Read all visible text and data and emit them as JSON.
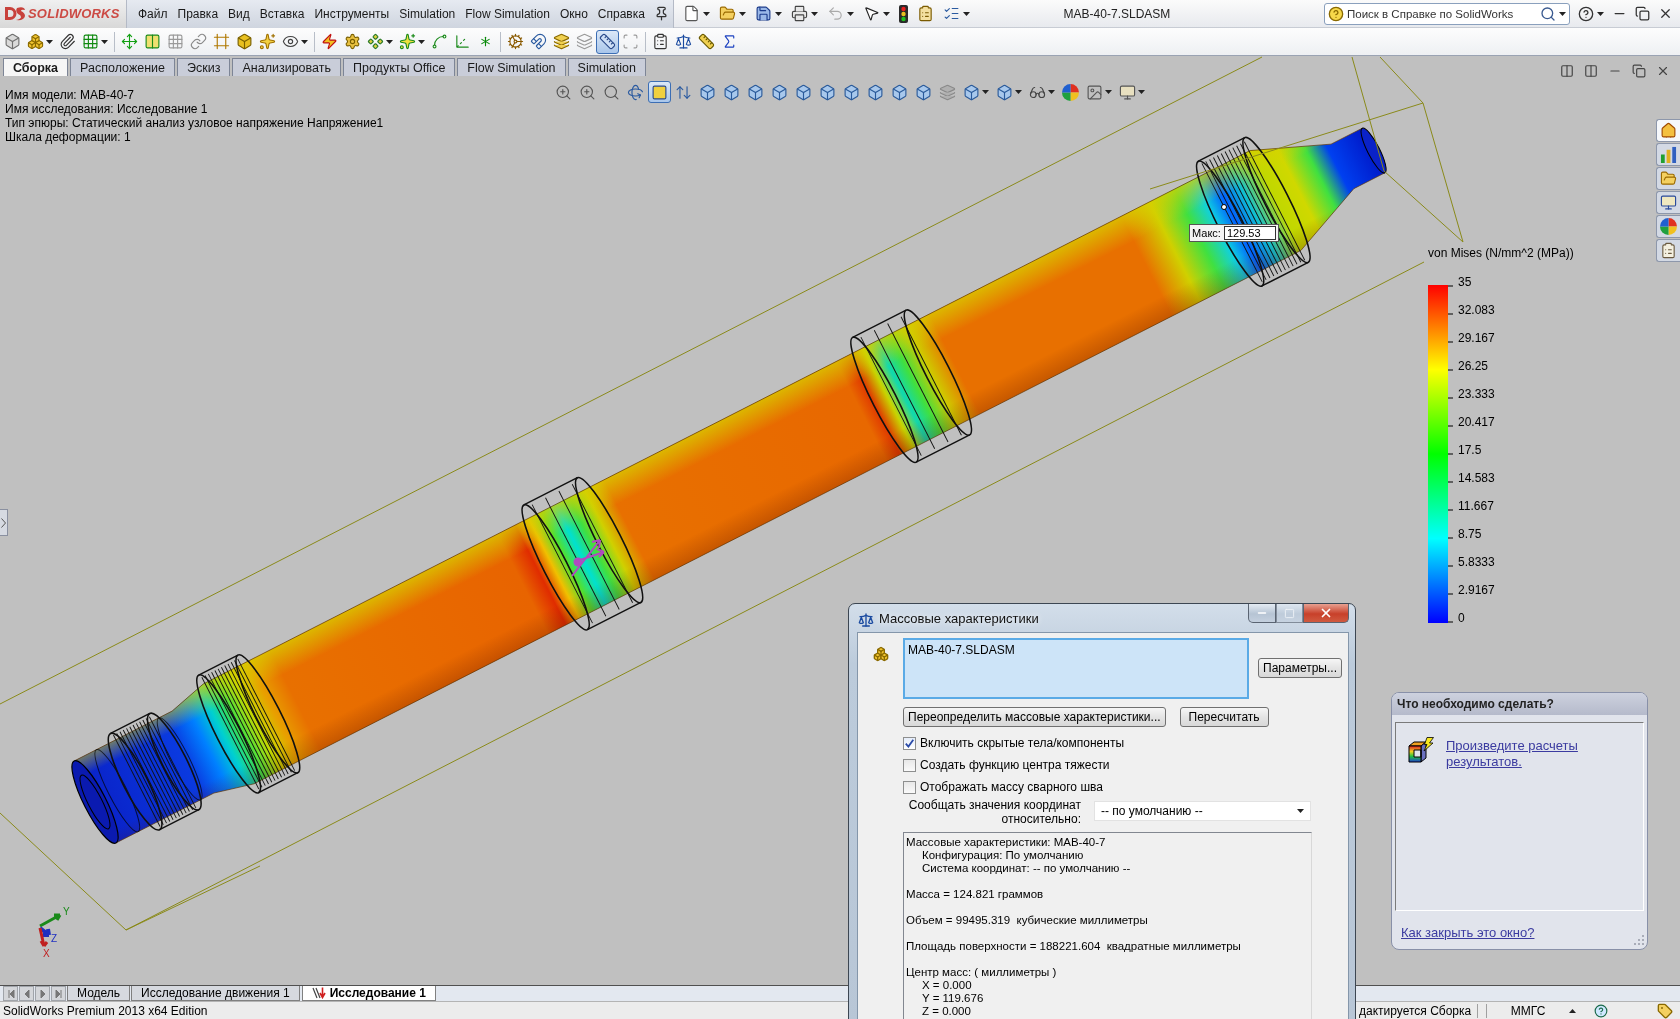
{
  "brand": {
    "name": "SOLIDWORKS"
  },
  "menu": [
    "Файл",
    "Правка",
    "Вид",
    "Вставка",
    "Инструменты",
    "Simulation",
    "Flow Simulation",
    "Окно",
    "Справка"
  ],
  "window": {
    "title": "MAB-40-7.SLDASM"
  },
  "help_search": {
    "placeholder": "Поиск в Справке по SolidWorks"
  },
  "standard_toolbar": [
    {
      "pressed": false
    },
    {
      "pressed": false
    },
    {
      "pressed": false
    },
    {
      "pressed": false
    },
    {
      "pressed": false
    },
    {
      "pressed": false
    },
    {
      "pressed": false
    },
    {
      "pressed": false
    },
    {
      "pressed": false
    },
    {
      "pressed": false
    },
    {
      "pressed": false
    },
    {
      "pressed": false
    },
    {
      "pressed": false
    },
    {
      "pressed": false
    },
    {
      "pressed": false
    },
    {
      "pressed": false
    },
    {
      "pressed": false
    },
    {
      "pressed": false
    },
    {
      "pressed": false
    },
    {
      "pressed": false
    },
    {
      "pressed": false
    },
    {
      "pressed": false
    },
    {
      "pressed": false
    },
    {
      "pressed": true
    },
    {
      "pressed": false
    },
    {
      "pressed": false
    },
    {
      "pressed": false
    },
    {
      "pressed": false
    },
    {
      "pressed": false
    }
  ],
  "command_tabs": [
    {
      "label": "Сборка",
      "selected": true
    },
    {
      "label": "Расположение",
      "selected": false
    },
    {
      "label": "Эскиз",
      "selected": false
    },
    {
      "label": "Анализировать",
      "selected": false
    },
    {
      "label": "Продукты Office",
      "selected": false
    },
    {
      "label": "Flow Simulation",
      "selected": false
    },
    {
      "label": "Simulation",
      "selected": false
    }
  ],
  "model_info": [
    "Имя модели: MAB-40-7",
    "Имя исследования: Исследование 1",
    "Тип эпюры: Статический анализ узловое напряжение Напряжение1",
    "Шкала деформации: 1"
  ],
  "view_toolbar": [
    {
      "pressed": false
    },
    {
      "pressed": false
    },
    {
      "pressed": false
    },
    {
      "pressed": false
    },
    {
      "pressed": true
    },
    {
      "pressed": false
    },
    {
      "pressed": false
    },
    {
      "pressed": false
    },
    {
      "pressed": false
    },
    {
      "pressed": false
    },
    {
      "pressed": false
    },
    {
      "pressed": false
    },
    {
      "pressed": false
    },
    {
      "pressed": false
    },
    {
      "pressed": false
    },
    {
      "pressed": false
    },
    {
      "pressed": false
    },
    {
      "pressed": false
    },
    {
      "pressed": false
    },
    {
      "pressed": false
    },
    {
      "pressed": false
    },
    {
      "pressed": false
    },
    {
      "pressed": false
    }
  ],
  "task_pane_tabs": [
    {
      "selected": true
    },
    {
      "selected": false
    },
    {
      "selected": false
    },
    {
      "selected": false
    },
    {
      "selected": false
    },
    {
      "selected": false
    }
  ],
  "probe": {
    "label": "Макс:",
    "value": "129.53"
  },
  "legend": {
    "title": "von Mises (N/mm^2 (MPa))",
    "ticks": [
      "35",
      "32.083",
      "29.167",
      "26.25",
      "23.333",
      "20.417",
      "17.5",
      "14.583",
      "11.667",
      "8.75",
      "5.8333",
      "2.9167",
      "0"
    ]
  },
  "triad": {
    "axes": [
      "Y",
      "Z",
      "X"
    ]
  },
  "mass_dialog": {
    "title": "Массовые характеристики",
    "selection": "MAB-40-7.SLDASM",
    "options_button": "Параметры...",
    "override_button": "Переопределить массовые характеристики...",
    "recalc_button": "Пересчитать",
    "checkboxes": [
      {
        "label": "Включить скрытые тела/компоненты",
        "checked": true
      },
      {
        "label": "Создать функцию центра тяжести",
        "checked": false
      },
      {
        "label": "Отображать массу сварного шва",
        "checked": false
      }
    ],
    "coord_label": "Сообщать значения координат относительно:",
    "coord_select": "-- по умолчанию --",
    "results": [
      {
        "text": "Массовые характеристики: MAB-40-7",
        "children": [
          {
            "text": "Конфигурация: По умолчанию"
          },
          {
            "text": "Система координат: -- по умолчанию --"
          }
        ]
      },
      {
        "text": "Масса = 124.821 граммов"
      },
      {
        "text": "Объем = 99495.319  кубические миллиметры"
      },
      {
        "text": "Площадь поверхности = 188221.604  квадратные миллиметры"
      },
      {
        "text": "Центр масс: ( миллиметры )",
        "children": [
          {
            "text": "X = 0.000"
          },
          {
            "text": "Y = 119.676"
          },
          {
            "text": "Z = 0.000"
          }
        ]
      }
    ]
  },
  "task_panel": {
    "title": "Что необходимо сделать?",
    "action": "Произведите расчеты результатов.",
    "close_link": "Как закрыть это окно?"
  },
  "document_tabs": [
    {
      "label": "Модель",
      "kind": "model",
      "selected": false
    },
    {
      "label": "Исследование движения 1",
      "kind": "motion",
      "selected": false
    },
    {
      "label": "Исследование 1",
      "kind": "study",
      "selected": true
    }
  ],
  "status_bar": {
    "edition": "SolidWorks Premium 2013 x64 Edition",
    "mode": "дактируется Сборка",
    "units": "ММГС"
  }
}
